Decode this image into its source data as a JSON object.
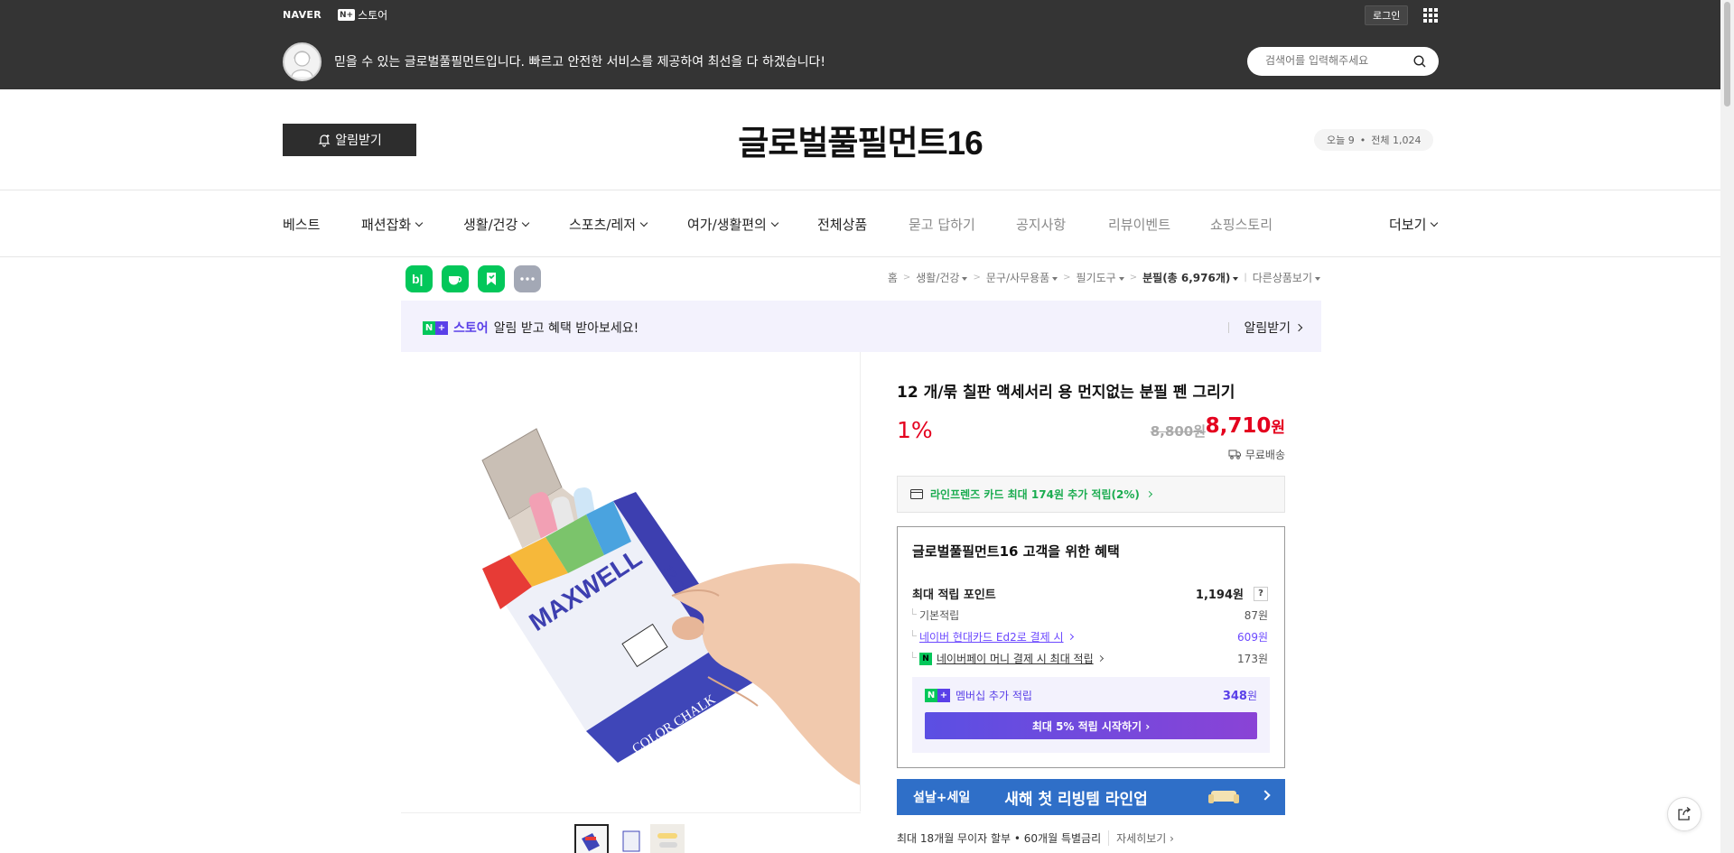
{
  "gnb": {
    "naver_logo": "NAVER",
    "npstore_badge": "N+",
    "npstore_label": "스토어",
    "login_label": "로그인",
    "apps_icon": "grid-icon"
  },
  "store_notice": {
    "message": "믿을 수 있는 글로벌풀필먼트입니다. 빠르고 안전한 서비스를 제공하여 최선을 다 하겠습니다!",
    "search_placeholder": "검색어를 입력해주세요"
  },
  "store_header": {
    "alarm_label": "알림받기",
    "title": "글로벌풀필먼트16",
    "visits_today": "오늘 9",
    "visits_total": "전체 1,024"
  },
  "nav": {
    "items": [
      {
        "label": "베스트",
        "dropdown": false,
        "gray": false
      },
      {
        "label": "패션잡화",
        "dropdown": true,
        "gray": false
      },
      {
        "label": "생활/건강",
        "dropdown": true,
        "gray": false
      },
      {
        "label": "스포츠/레저",
        "dropdown": true,
        "gray": false
      },
      {
        "label": "여가/생활편의",
        "dropdown": true,
        "gray": false
      },
      {
        "label": "전체상품",
        "dropdown": false,
        "gray": false
      },
      {
        "label": "묻고 답하기",
        "dropdown": false,
        "gray": true
      },
      {
        "label": "공지사항",
        "dropdown": false,
        "gray": true
      },
      {
        "label": "리뷰이벤트",
        "dropdown": false,
        "gray": true
      },
      {
        "label": "쇼핑스토리",
        "dropdown": false,
        "gray": true
      }
    ],
    "more_label": "더보기"
  },
  "share_icons": [
    {
      "name": "blog-share-icon",
      "glyph": "b|",
      "color": "#03c75a"
    },
    {
      "name": "cafe-share-icon",
      "glyph": "☕",
      "color": "#03c75a"
    },
    {
      "name": "bookmark-share-icon",
      "glyph": "⚑",
      "color": "#03c75a"
    },
    {
      "name": "more-share-icon",
      "glyph": "•••",
      "color": "#a3a8b5"
    }
  ],
  "breadcrumb": {
    "home": "홈",
    "c1": "생활/건강",
    "c2": "문구/사무용품",
    "c3": "필기도구",
    "c4": "분필(총 6,976개)",
    "other": "다른상품보기"
  },
  "promo": {
    "badge": "N+",
    "store": "스토어",
    "text": "알림 받고 혜택 받아보세요!",
    "action": "알림받기"
  },
  "product": {
    "title": "12 개/묶 칠판 액세서리 용 먼지없는 분필 펜 그리기",
    "discount": "1%",
    "original_price": "8,800원",
    "price_number": "8,710",
    "price_unit": "원",
    "shipping": "무료배송",
    "card_benefit": "라인프렌즈 카드 최대 174원 추가 적립(2%)",
    "thumbnails": 3
  },
  "benefit": {
    "title": "글로벌풀필먼트16 고객을 위한 혜택",
    "max_point_label": "최대 적립 포인트",
    "max_point_value": "1,194원",
    "help": "?",
    "basic_label": "기본적립",
    "basic_value": "87원",
    "card_label": "네이버 현대카드 Ed2로 결제 시",
    "card_value": "609원",
    "npay_label": "네이버페이 머니 결제 시 최대 적립",
    "npay_value": "173원",
    "membership_label": "멤버십 추가 적립",
    "membership_value": "348",
    "membership_unit": "원",
    "membership_button": "최대 5% 적립 시작하기"
  },
  "sale_banner": {
    "left": "설날+세일",
    "text": "새해 첫 리빙템 라인업"
  },
  "installment": {
    "text": "최대 18개월 무이자 할부 • 60개월 특별금리",
    "more": "자세히보기"
  },
  "colors": {
    "header_bg": "#343434",
    "naver_green": "#03c75a",
    "price_red": "#e4001e",
    "membership_purple": "#5a40e8",
    "sale_blue": "#2f6fc8"
  }
}
